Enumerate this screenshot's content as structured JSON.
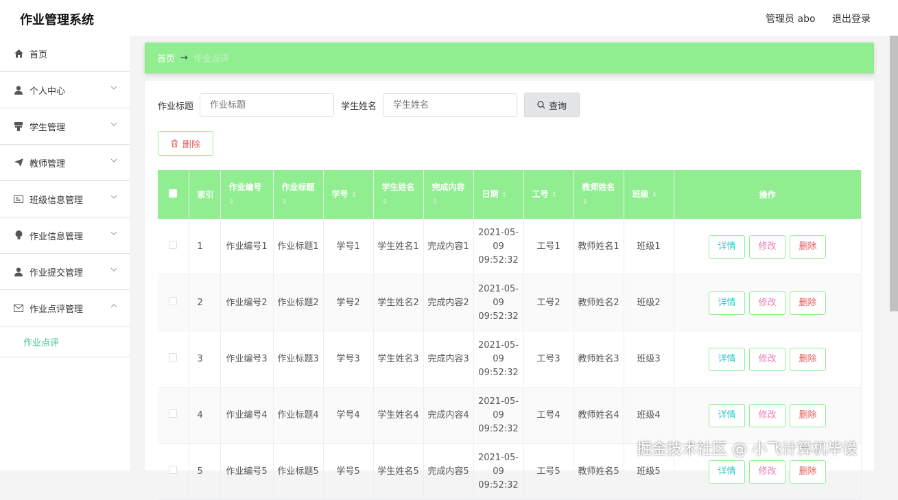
{
  "header": {
    "title": "作业管理系统",
    "user": "管理员 abo",
    "logout": "退出登录"
  },
  "sidebar": {
    "items": [
      {
        "label": "首页",
        "icon": "home-icon"
      },
      {
        "label": "个人中心",
        "icon": "user-icon"
      },
      {
        "label": "学生管理",
        "icon": "podium-icon"
      },
      {
        "label": "教师管理",
        "icon": "send-icon"
      },
      {
        "label": "班级信息管理",
        "icon": "card-icon"
      },
      {
        "label": "作业信息管理",
        "icon": "bulb-icon"
      },
      {
        "label": "作业提交管理",
        "icon": "user-icon"
      },
      {
        "label": "作业点评管理",
        "icon": "mail-icon"
      }
    ],
    "sub_item": "作业点评"
  },
  "breadcrumb": {
    "home": "首页",
    "arrow": "→",
    "current": "作业点评"
  },
  "search": {
    "title_label": "作业标题",
    "title_placeholder": "作业标题",
    "name_label": "学生姓名",
    "name_placeholder": "学生姓名",
    "button": "查询"
  },
  "toolbar": {
    "delete": "删除"
  },
  "table": {
    "headers": {
      "index": "索引",
      "hw_no": "作业编号",
      "hw_title": "作业标题",
      "stu_no": "学号",
      "stu_name": "学生姓名",
      "content": "完成内容",
      "date": "日期",
      "emp_no": "工号",
      "teacher": "教师姓名",
      "grade": "班级",
      "ops": "操作"
    },
    "sort_mark": "⇕",
    "rows": [
      {
        "index": "1",
        "hw_no": "作业编号1",
        "hw_title": "作业标题1",
        "stu_no": "学号1",
        "stu_name": "学生姓名1",
        "content": "完成内容1",
        "date": "2021-05-09 09:52:32",
        "emp_no": "工号1",
        "teacher": "教师姓名1",
        "grade": "班级1"
      },
      {
        "index": "2",
        "hw_no": "作业编号2",
        "hw_title": "作业标题2",
        "stu_no": "学号2",
        "stu_name": "学生姓名2",
        "content": "完成内容2",
        "date": "2021-05-09 09:52:32",
        "emp_no": "工号2",
        "teacher": "教师姓名2",
        "grade": "班级2"
      },
      {
        "index": "3",
        "hw_no": "作业编号3",
        "hw_title": "作业标题3",
        "stu_no": "学号3",
        "stu_name": "学生姓名3",
        "content": "完成内容3",
        "date": "2021-05-09 09:52:32",
        "emp_no": "工号3",
        "teacher": "教师姓名3",
        "grade": "班级3"
      },
      {
        "index": "4",
        "hw_no": "作业编号4",
        "hw_title": "作业标题4",
        "stu_no": "学号4",
        "stu_name": "学生姓名4",
        "content": "完成内容4",
        "date": "2021-05-09 09:52:32",
        "emp_no": "工号4",
        "teacher": "教师姓名4",
        "grade": "班级4"
      },
      {
        "index": "5",
        "hw_no": "作业编号5",
        "hw_title": "作业标题5",
        "stu_no": "学号5",
        "stu_name": "学生姓名5",
        "content": "完成内容5",
        "date": "2021-05-09 09:52:32",
        "emp_no": "工号5",
        "teacher": "教师姓名5",
        "grade": "班级5"
      }
    ],
    "op_labels": {
      "detail": "详情",
      "edit": "修改",
      "delete": "删除"
    }
  },
  "watermark": "掘金技术社区 @ 小飞计算机毕设",
  "colors": {
    "accent": "#90ee90",
    "active": "#3ac08a",
    "danger": "#e35d5d"
  }
}
